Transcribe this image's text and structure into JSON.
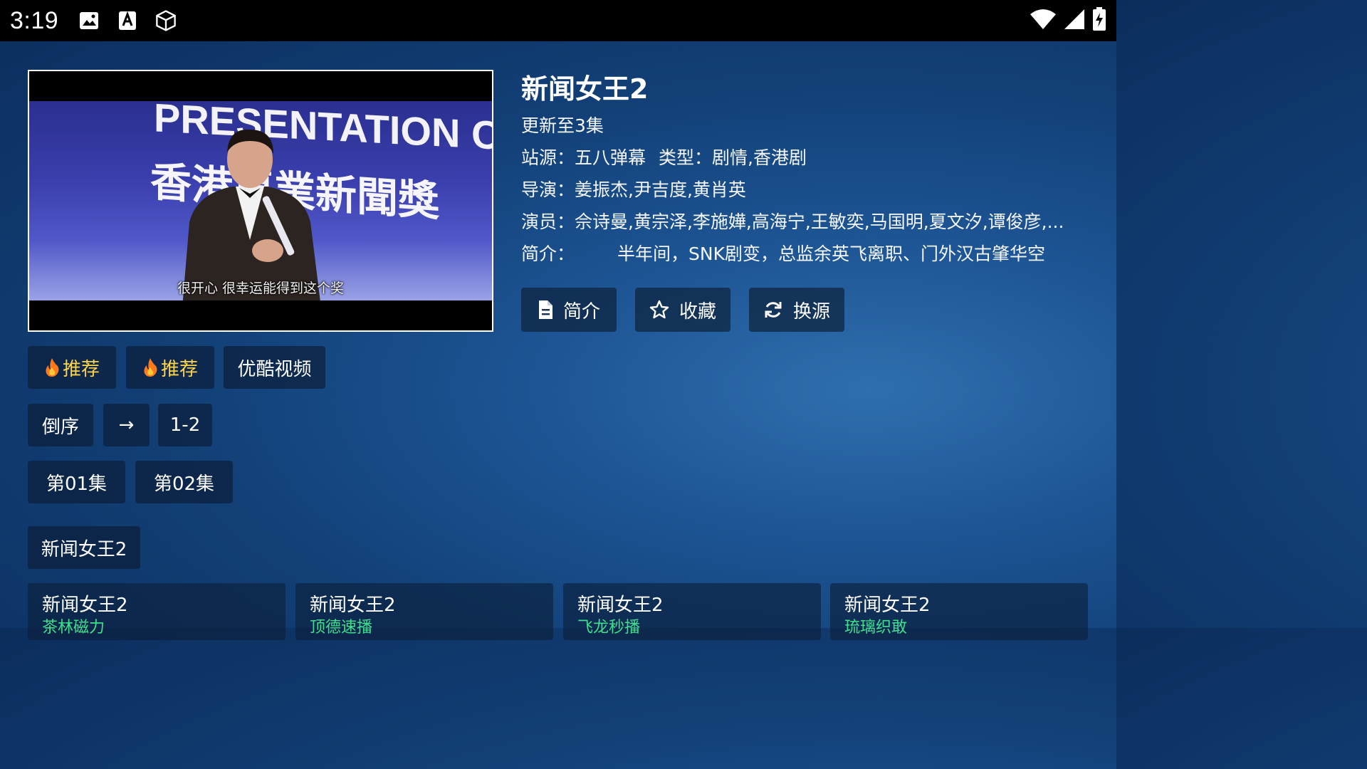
{
  "status_bar": {
    "time": "3:19",
    "left_icons": [
      "image-icon",
      "font-a-icon",
      "cube-icon"
    ],
    "right_icons": [
      "wifi-icon",
      "cell-signal-icon",
      "battery-charging-icon"
    ]
  },
  "poster": {
    "banner_line1": "PRESENTATION CERE",
    "banner_line2": "香港專業新聞獎",
    "subtitle": "很开心 很幸运能得到这个奖"
  },
  "detail": {
    "title": "新闻女王2",
    "update": "更新至3集",
    "site_label": "站源：",
    "site": "五八弹幕",
    "type_label": "类型：",
    "type": "剧情,香港剧",
    "director_label": "导演：",
    "director": "姜振杰,尹吉度,黄肖英",
    "actors_label": "演员：",
    "actors": "佘诗曼,黄宗泽,李施嬅,高海宁,王敏奕,马国明,夏文汐,谭俊彦,...",
    "intro_label": "简介：",
    "intro": "半年间，SNK剧变，总监余英飞离职、门外汉古肇华空"
  },
  "actions": {
    "intro": "简介",
    "favorite": "收藏",
    "switch_source": "换源"
  },
  "sources": [
    {
      "label": "推荐",
      "hot": true
    },
    {
      "label": "推荐",
      "hot": true
    },
    {
      "label": "优酷视频",
      "hot": false
    }
  ],
  "order": {
    "reverse": "倒序",
    "arrow": "→",
    "range": "1-2"
  },
  "episodes": [
    "第01集",
    "第02集"
  ],
  "series_chip": "新闻女王2",
  "related": [
    {
      "title": "新闻女王2",
      "sub": "茶林磁力"
    },
    {
      "title": "新闻女王2",
      "sub": "顶德速播"
    },
    {
      "title": "新闻女王2",
      "sub": "飞龙秒播"
    },
    {
      "title": "新闻女王2",
      "sub": "琉璃织敢"
    }
  ],
  "colors": {
    "hot_gold": "#ffd44a",
    "related_sub": "#3ee08c",
    "statusbar": "#000000"
  }
}
